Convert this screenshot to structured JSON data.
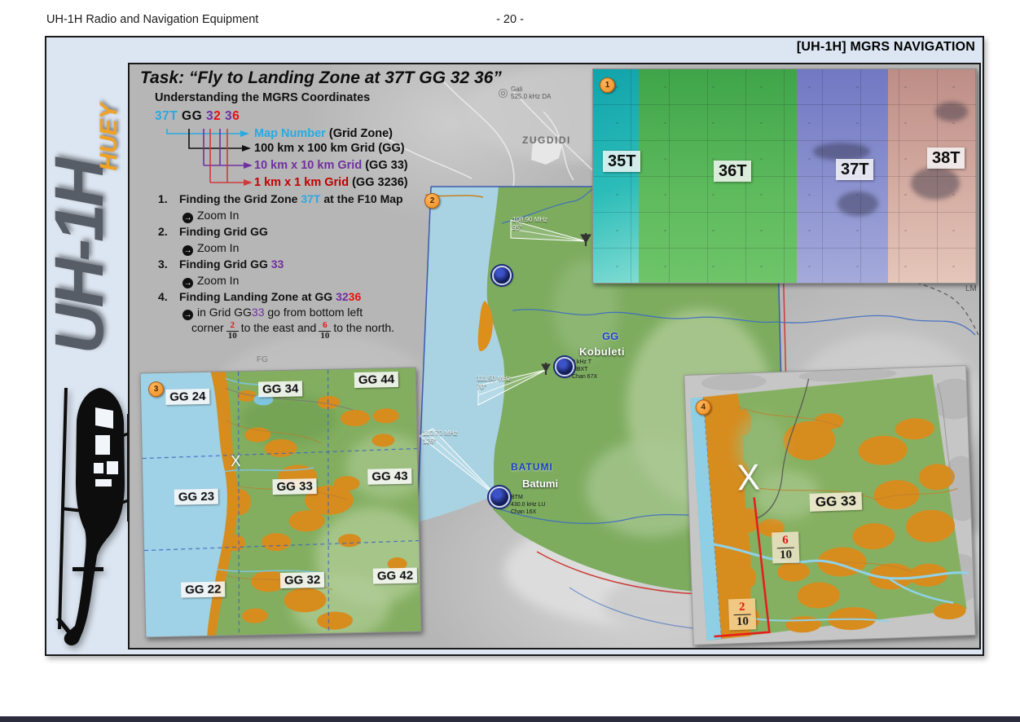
{
  "page": {
    "header_left": "UH-1H Radio and Navigation Equipment",
    "page_number": "- 20 -"
  },
  "banner": {
    "title": "[UH-1H] MGRS NAVIGATION"
  },
  "logo": {
    "main": "UH-1H",
    "sub": "HUEY"
  },
  "palette": {
    "grid_zone_cyan": "#29aae2",
    "grid10_purple": "#7030a0",
    "grid1_dark_red": "#c00000",
    "highlight_red": "#e80f0f",
    "badge_orange": "#ee8c1e",
    "box_background_blue": "#dce6f2"
  },
  "task": {
    "title": "Task: “Fly to Landing Zone at 37T GG 32 36”",
    "subtitle": "Understanding the MGRS Coordinates",
    "coord": {
      "zone": "37T",
      "grid": "GG",
      "p1": "3",
      "r1": "2",
      "p2": "3",
      "r2": "6"
    },
    "legend": {
      "row1_colored": "Map Number",
      "row1_black": "(Grid Zone)",
      "row2_black": "100 km x 100 km Grid (GG)",
      "row3_colored": "10 km x 10 km Grid",
      "row3_black": "(GG 33)",
      "row4_colored": "1 km x 1 km Grid",
      "row4_black": "(GG 3236)"
    },
    "steps": {
      "s1_num": "1.",
      "s1_a": "Finding the Grid Zone ",
      "s1_zone": "37T",
      "s1_b": " at the F10 Map",
      "zoom_icon": "→",
      "zoom_in": "Zoom In",
      "s2_num": "2.",
      "s2_a": "Finding Grid GG",
      "s3_num": "3.",
      "s3_a": "Finding Grid GG ",
      "s3_purple": "33",
      "s4_num": "4.",
      "s4_a": "Finding Landing Zone at GG ",
      "s4_purple": "32",
      "s4_red": "36",
      "s4_sub1_a": "in Grid GG",
      "s4_sub1_purple": "33",
      "s4_sub1_b": " go from bottom left",
      "s4_sub2_a": "corner",
      "frac_east_num": "2",
      "frac_east_den": "10",
      "s4_sub2_b": "to the east and",
      "frac_north_num": "6",
      "frac_north_den": "10",
      "s4_sub2_c": "to the north."
    }
  },
  "main_map": {
    "badge": "2",
    "gali_name": "Gali",
    "gali_freq": "525.0 kHz DA",
    "zugdidi": "ZUGDIDI",
    "gg_label": "GG",
    "kobuleti_city": "Kobuleti",
    "kobuleti_station": [
      "0 kHz T",
      "MBXT",
      "Chan 67X"
    ],
    "batumi_caps": "BATUMI",
    "batumi_city": "Batumi",
    "batumi_station": [
      "BTM",
      "430.0 kHz LU",
      "Chan 16X"
    ],
    "freq_nw": {
      "mhz": "108.90 MHz",
      "brg": "95°"
    },
    "freq_kobuleti": {
      "mhz": "111.50 MHz",
      "brg": "70°"
    },
    "freq_batumi": {
      "mhz": "110.70 MHz",
      "brg": "126°"
    },
    "lm": "LM",
    "fg": "FG"
  },
  "inset_zones": {
    "badge": "1",
    "zones": [
      "35T",
      "36T",
      "37T",
      "38T"
    ]
  },
  "inset_grid": {
    "badge": "3",
    "row_top": [
      "GG 24",
      "GG 34",
      "GG 44"
    ],
    "row_mid": [
      "GG 23",
      "GG 33",
      "GG 43"
    ],
    "row_bot": [
      "GG 22",
      "GG 32",
      "GG 42"
    ],
    "x_mark": "X"
  },
  "inset_lz": {
    "badge": "4",
    "grid_label": "GG 33",
    "north_num": "6",
    "north_den": "10",
    "east_num": "2",
    "east_den": "10",
    "x_mark": "X"
  }
}
